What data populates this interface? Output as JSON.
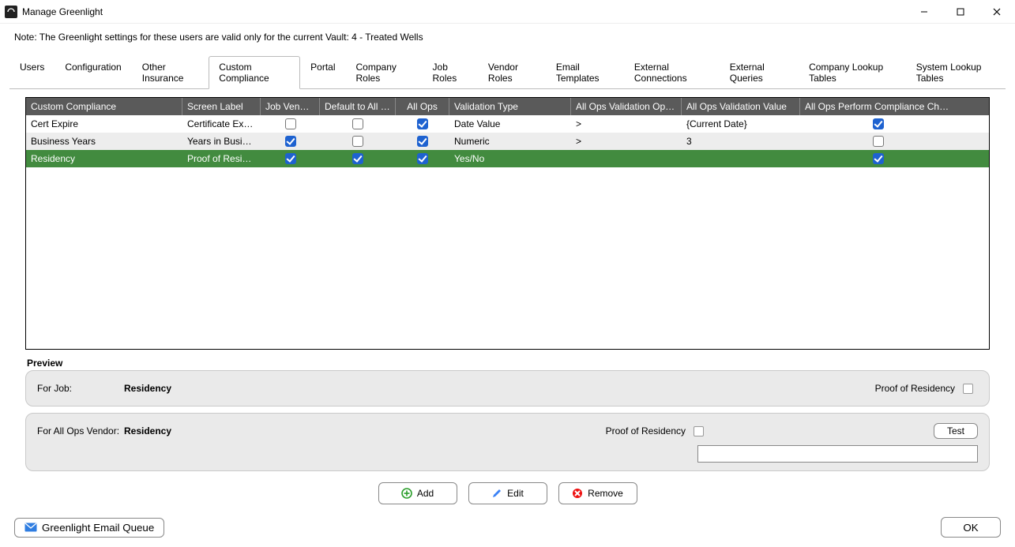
{
  "window": {
    "title": "Manage Greenlight",
    "note": "Note:  The Greenlight settings for these users are valid only for the current Vault: 4 - Treated Wells"
  },
  "tabs": [
    "Users",
    "Configuration",
    "Other Insurance",
    "Custom Compliance",
    "Portal",
    "Company Roles",
    "Job Roles",
    "Vendor Roles",
    "Email Templates",
    "External Connections",
    "External Queries",
    "Company Lookup Tables",
    "System Lookup Tables"
  ],
  "activeTab": "Custom Compliance",
  "grid": {
    "headers": [
      "Custom Compliance",
      "Screen Label",
      "Job Vendors",
      "Default to All Jobs",
      "All Ops",
      "Validation Type",
      "All Ops Validation Operator",
      "All Ops Validation Value",
      "All Ops Perform Compliance Check"
    ],
    "rows": [
      {
        "name": "Cert Expire",
        "screen": "Certificate Expirati...",
        "jobVendors": false,
        "defaultAll": false,
        "allOps": true,
        "valType": "Date Value",
        "op": ">",
        "val": "{Current Date}",
        "check": true,
        "selected": false,
        "alt": false
      },
      {
        "name": "Business Years",
        "screen": "Years in Business",
        "jobVendors": true,
        "defaultAll": false,
        "allOps": true,
        "valType": "Numeric",
        "op": ">",
        "val": "3",
        "check": false,
        "selected": false,
        "alt": true
      },
      {
        "name": "Residency",
        "screen": "Proof of Residency",
        "jobVendors": true,
        "defaultAll": true,
        "allOps": true,
        "valType": "Yes/No",
        "op": "",
        "val": "",
        "check": true,
        "selected": true,
        "alt": false
      }
    ]
  },
  "preview": {
    "title": "Preview",
    "job": {
      "label": "For Job:",
      "value": "Residency",
      "proofLabel": "Proof of Residency"
    },
    "vendor": {
      "label": "For All Ops Vendor:",
      "value": "Residency",
      "proofLabel": "Proof of Residency",
      "testLabel": "Test"
    }
  },
  "actions": {
    "add": "Add",
    "edit": "Edit",
    "remove": "Remove"
  },
  "footer": {
    "queue": "Greenlight Email Queue",
    "ok": "OK"
  }
}
